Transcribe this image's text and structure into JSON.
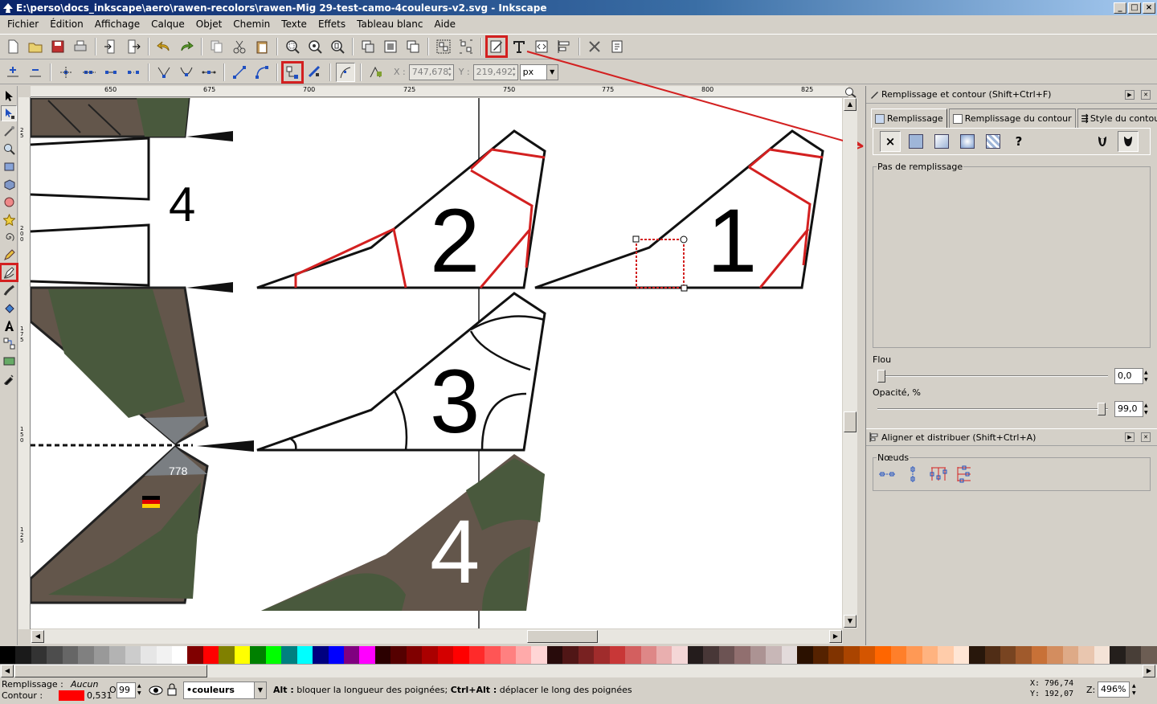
{
  "window": {
    "title": "E:\\perso\\docs_inkscape\\aero\\rawen-recolors\\rawen-Mig 29-test-camo-4couleurs-v2.svg - Inkscape",
    "min_btn": "_",
    "max_btn": "□",
    "close_btn": "×"
  },
  "menu": [
    "Fichier",
    "Édition",
    "Affichage",
    "Calque",
    "Objet",
    "Chemin",
    "Texte",
    "Effets",
    "Tableau blanc",
    "Aide"
  ],
  "toolbar2": {
    "x_label": "X :",
    "x_value": "747,678",
    "y_label": "Y :",
    "y_value": "219,492",
    "unit": "px"
  },
  "ruler_top": [
    "650",
    "675",
    "700",
    "725",
    "750",
    "775",
    "800",
    "825"
  ],
  "ruler_left": [
    "2 5",
    "2 0 0",
    "1 7 5",
    "1 5 0",
    "1 2 5"
  ],
  "canvas": {
    "labels": [
      "4",
      "2",
      "1",
      "3",
      "4"
    ],
    "badge_number": "778"
  },
  "fill_stroke_panel": {
    "title": "Remplissage et contour (Shift+Ctrl+F)",
    "tabs": [
      "Remplissage",
      "Remplissage du contour",
      "Style du contour"
    ],
    "fill_types": [
      "none-x",
      "flat",
      "linear",
      "radial",
      "pattern",
      "unset"
    ],
    "unset_glyph": "?",
    "x_glyph": "×",
    "no_fill_label": "Pas de remplissage",
    "blur_label": "Flou",
    "blur_value": "0,0",
    "opacity_label": "Opacité, %",
    "opacity_value": "99,0",
    "opacity_level": 0.99
  },
  "align_panel": {
    "title": "Aligner et distribuer (Shift+Ctrl+A)",
    "nodes_label": "Nœuds"
  },
  "palette": [
    "#000000",
    "#1a1a1a",
    "#333333",
    "#4d4d4d",
    "#666666",
    "#808080",
    "#999999",
    "#b3b3b3",
    "#cccccc",
    "#e6e6e6",
    "#f2f2f2",
    "#ffffff",
    "#800000",
    "#ff0000",
    "#808000",
    "#ffff00",
    "#008000",
    "#00ff00",
    "#008080",
    "#00ffff",
    "#000080",
    "#0000ff",
    "#800080",
    "#ff00ff",
    "#2b0000",
    "#550000",
    "#800000",
    "#aa0000",
    "#d40000",
    "#ff0000",
    "#ff2a2a",
    "#ff5555",
    "#ff8080",
    "#ffaaaa",
    "#ffd5d5",
    "#280b0b",
    "#501616",
    "#782121",
    "#a02c2c",
    "#c83737",
    "#d35f5f",
    "#de8787",
    "#e9afaf",
    "#f4d7d7",
    "#241c1c",
    "#483737",
    "#6c5353",
    "#916f6f",
    "#ac9393",
    "#c8b7b7",
    "#e3dbdb",
    "#2b1100",
    "#552200",
    "#803300",
    "#aa4400",
    "#d45500",
    "#ff6600",
    "#ff7f2a",
    "#ff9955",
    "#ffb380",
    "#ffccaa",
    "#ffe6d5",
    "#28170b",
    "#502d16",
    "#784421",
    "#a05a2c",
    "#c87137",
    "#d38d5f",
    "#deaa87",
    "#e9c6af",
    "#f4e3d7",
    "#241f1c",
    "#483e37",
    "#6c5d53"
  ],
  "status": {
    "fill_label": "Remplissage :",
    "fill_value": "Aucun",
    "stroke_label": "Contour :",
    "stroke_color": "#ff0000",
    "stroke_width": "0,531",
    "opacity_label": "O",
    "opacity_value": "99",
    "layer": "•couleurs",
    "message_b1": "Alt :",
    "message_t1": " bloquer la longueur des poignées; ",
    "message_b2": "Ctrl+Alt :",
    "message_t2": " déplacer le long des poignées",
    "x_label": "X:",
    "x_value": "796,74",
    "y_label": "Y:",
    "y_value": "192,07",
    "z_label": "Z:",
    "zoom_value": "496%"
  },
  "colors": {
    "highlight": "#d32020",
    "camo_brown": "#63564b",
    "camo_green": "#49593d",
    "camo_grey": "#7a7e82"
  }
}
